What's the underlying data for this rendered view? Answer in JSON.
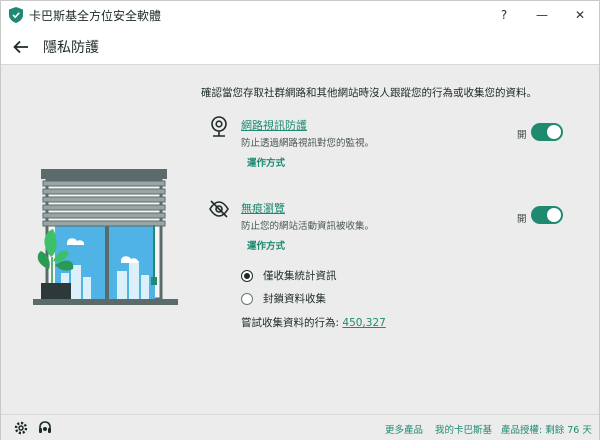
{
  "window": {
    "title": "卡巴斯基全方位安全軟體",
    "controls": {
      "help": "?",
      "minimize": "—",
      "close": "✕"
    }
  },
  "header": {
    "title": "隱私防護"
  },
  "intro": "確認當您存取社群網路和其他網站時沒人跟蹤您的行為或收集您的資料。",
  "features": [
    {
      "icon": "webcam-icon",
      "title": "網路視訊防護",
      "desc": "防止透過網路視訊對您的監視。",
      "howto": "運作方式",
      "state_label": "開",
      "enabled": true
    },
    {
      "icon": "eye-slash-icon",
      "title": "無痕瀏覽",
      "desc": "防止您的網站活動資訊被收集。",
      "howto": "運作方式",
      "state_label": "開",
      "enabled": true
    }
  ],
  "options": [
    {
      "label": "僅收集統計資訊",
      "selected": true
    },
    {
      "label": "封鎖資料收集",
      "selected": false
    }
  ],
  "attempts": {
    "label": "嘗試收集資料的行為:",
    "count": "450,327"
  },
  "footer": {
    "links": [
      "更多產品",
      "我的卡巴斯基",
      "產品授權: 剩餘 76 天"
    ],
    "icons": [
      "gear-icon",
      "support-icon"
    ]
  },
  "colors": {
    "accent": "#1f8a70",
    "background": "#ececec"
  }
}
